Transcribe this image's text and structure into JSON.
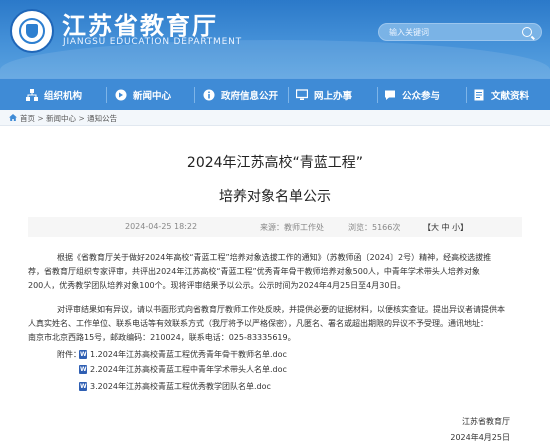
{
  "header": {
    "title": "江苏省教育厅",
    "subtitle": "JIANGSU EDUCATION DEPARTMENT",
    "search_placeholder": "输入关键词",
    "brand_color": "#2b79c9"
  },
  "nav": {
    "items": [
      {
        "label": "组织机构",
        "icon": "org-icon"
      },
      {
        "label": "新闻中心",
        "icon": "news-icon"
      },
      {
        "label": "政府信息公开",
        "icon": "info-icon"
      },
      {
        "label": "网上办事",
        "icon": "online-service-icon"
      },
      {
        "label": "公众参与",
        "icon": "people-icon"
      },
      {
        "label": "文献资料",
        "icon": "document-icon"
      }
    ]
  },
  "breadcrumb": {
    "home": "首页",
    "sep1": " > ",
    "section": "新闻中心",
    "sep2": " > ",
    "current": "通知公告"
  },
  "article": {
    "title_line1": "2024年江苏高校“青蓝工程”",
    "title_line2": "培养对象名单公示",
    "date": "2024-04-25 18:22",
    "source": "来源：教师工作处",
    "views": "浏览：5166次",
    "font_open": "【",
    "font_large": "大",
    "font_medium": "中",
    "font_small": "小",
    "font_close": "】",
    "para1": [
      "根据《省教育厅关于做好2024年高校“青蓝工程”培养对象选拔工作的通知》（苏教师函〔2024〕2号）精神，经高校选拔推",
      "荐，省教育厅组织专家评审，共评出2024年江苏高校“青蓝工程”优秀青年骨干教师培养对象500人，中青年学术带头人培养对象",
      "200人，优秀教学团队培养对象100个。现将评审结果予以公示。公示时间为2024年4月25日至4月30日。"
    ],
    "para2": [
      "对评审结果如有异议，请以书面形式向省教育厅教师工作处反映，并提供必要的证据材料，以便核实查证。提出异议者请提供本",
      "人真实姓名、工作单位、联系电话等有效联系方式（我厅将予以严格保密），凡匿名、署名或超出期限的异议不予受理。通讯地址：",
      "南京市北京西路15号，邮政编码：210024，联系电话：025-83335619。"
    ],
    "attachments_label": "附件：",
    "attachments": [
      "1.2024年江苏高校青蓝工程优秀青年骨干教师名单.doc",
      "2.2024年江苏高校青蓝工程中青年学术带头人名单.doc",
      "3.2024年江苏高校青蓝工程优秀教学团队名单.doc"
    ],
    "signature": "江苏省教育厅",
    "sign_date": "2024年4月25日"
  }
}
